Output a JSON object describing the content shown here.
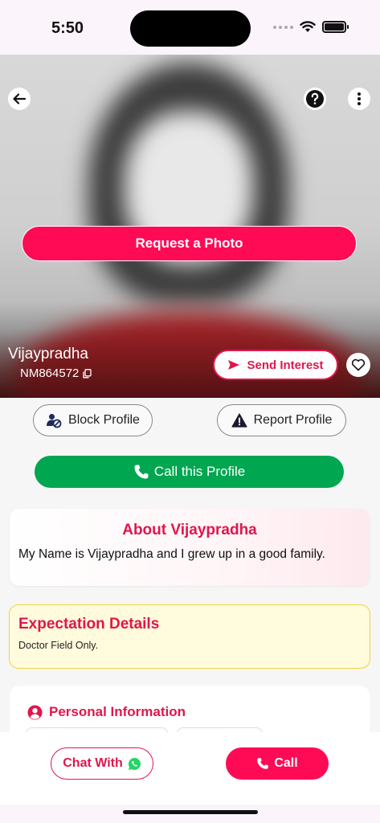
{
  "status_bar": {
    "time": "5:50"
  },
  "hero": {
    "request_photo_label": "Request a Photo",
    "name": "Vijaypradha",
    "profile_id": "NM864572",
    "send_interest_label": "Send Interest"
  },
  "actions": {
    "block_label": "Block Profile",
    "report_label": "Report Profile",
    "call_profile_label": "Call this Profile"
  },
  "about": {
    "title": "About Vijaypradha",
    "text": "My Name is Vijaypradha and I grew up in a good family."
  },
  "expectation": {
    "title": "Expectation Details",
    "text": "Doctor Field Only."
  },
  "personal": {
    "title": "Personal Information"
  },
  "bottom_bar": {
    "chat_label": "Chat With",
    "call_label": "Call"
  },
  "colors": {
    "accent": "#ff0a54",
    "accent_text": "#e0164c",
    "call_green": "#00a650",
    "expectation_bg": "#fffbdc",
    "expectation_border": "#f2d23a"
  },
  "icons": [
    "back-arrow-icon",
    "help-icon",
    "more-vertical-icon",
    "copy-icon",
    "send-icon",
    "heart-icon",
    "block-user-icon",
    "warning-icon",
    "phone-icon",
    "user-circle-icon",
    "whatsapp-icon",
    "wifi-icon",
    "battery-icon"
  ]
}
